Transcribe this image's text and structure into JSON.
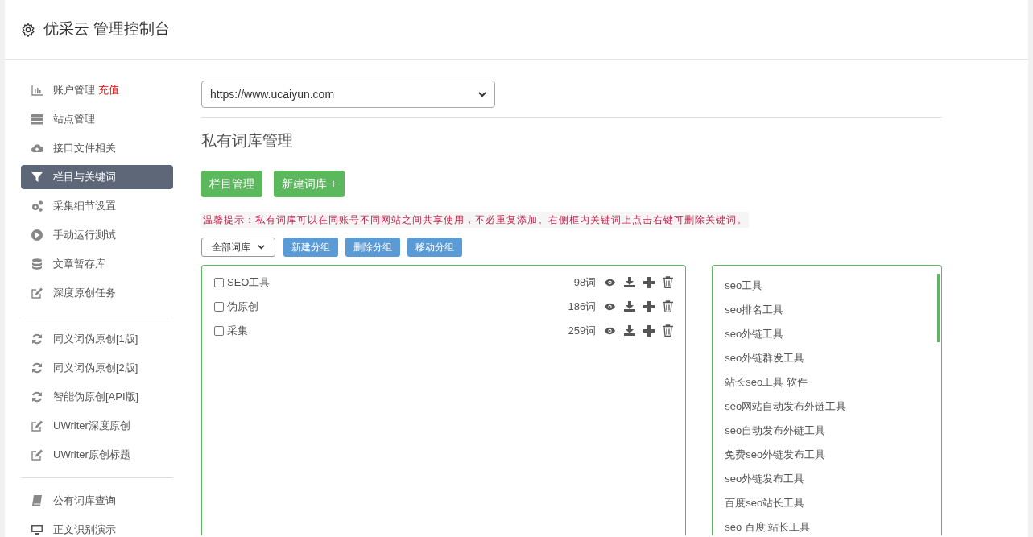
{
  "header": {
    "title": "优采云 管理控制台"
  },
  "sidebar": {
    "groups": [
      {
        "items": [
          {
            "label": "账户管理",
            "badge": "充值",
            "selected": false
          },
          {
            "label": "站点管理",
            "selected": false
          },
          {
            "label": "接口文件相关",
            "selected": false
          },
          {
            "label": "栏目与关键词",
            "selected": true
          },
          {
            "label": "采集细节设置",
            "selected": false
          },
          {
            "label": "手动运行测试",
            "selected": false
          },
          {
            "label": "文章暂存库",
            "selected": false
          },
          {
            "label": "深度原创任务",
            "selected": false
          }
        ]
      },
      {
        "items": [
          {
            "label": "同义词伪原创[1版]",
            "selected": false
          },
          {
            "label": "同义词伪原创[2版]",
            "selected": false
          },
          {
            "label": "智能伪原创[API版]",
            "selected": false
          },
          {
            "label": "UWriter深度原创",
            "selected": false
          },
          {
            "label": "UWriter原创标题",
            "selected": false
          }
        ]
      },
      {
        "items": [
          {
            "label": "公有词库查询",
            "selected": false
          },
          {
            "label": "正文识别演示",
            "selected": false
          }
        ]
      }
    ]
  },
  "site_select": {
    "value": "https://www.ucaiyun.com"
  },
  "page_title": "私有词库管理",
  "primary_buttons": [
    "栏目管理",
    "新建词库 +"
  ],
  "tip": "温馨提示：私有词库可以在同账号不同网站之间共享使用，不必重复添加。右侧框内关键词上点击右键可删除关键词。",
  "group_select": {
    "value": "全部词库"
  },
  "group_buttons": [
    "新建分组",
    "删除分组",
    "移动分组"
  ],
  "libraries": [
    {
      "name": "SEO工具",
      "count": "98词",
      "checked": false
    },
    {
      "name": "伪原创",
      "count": "186词",
      "checked": false
    },
    {
      "name": "采集",
      "count": "259词",
      "checked": false
    }
  ],
  "keywords": [
    "seo工具",
    "seo排名工具",
    "seo外链工具",
    "seo外链群发工具",
    "站长seo工具 软件",
    "seo网站自动发布外链工具",
    "seo自动发布外链工具",
    "免费seo外链发布工具",
    "seo外链发布工具",
    "百度seo站长工具",
    "seo 百度 站长工具"
  ]
}
